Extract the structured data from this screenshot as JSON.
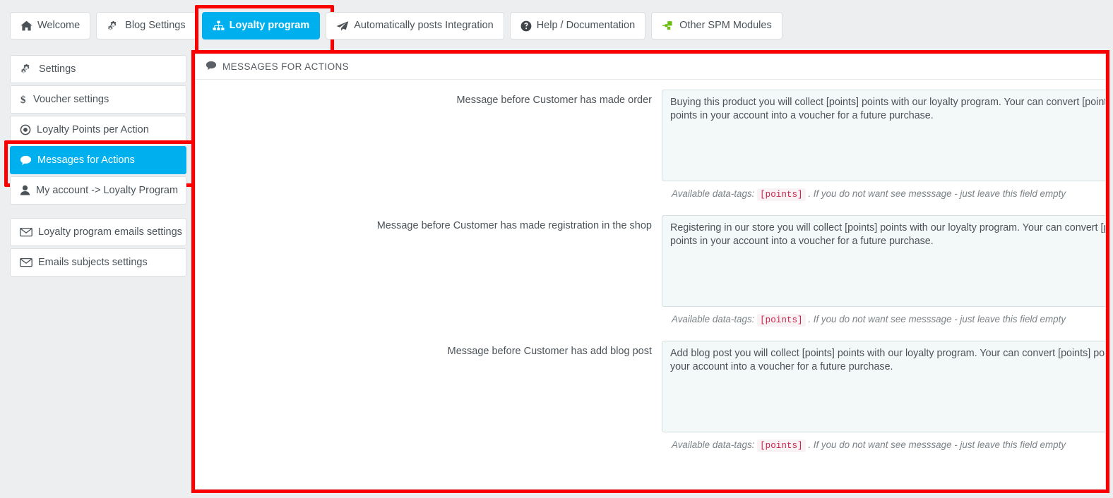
{
  "colors": {
    "accent": "#00b0ee",
    "annotation": "#fb0000",
    "page_bg": "#eceef0",
    "text": "#4c5358",
    "code": "#c7254e"
  },
  "tabs": [
    {
      "label": "Welcome",
      "icon": "home-icon",
      "active": false
    },
    {
      "label": "Blog Settings",
      "icon": "gears-icon",
      "active": false
    },
    {
      "label": "Loyalty program",
      "icon": "sitemap-icon",
      "active": true
    },
    {
      "label": "Automatically posts Integration",
      "icon": "paper-plane-icon",
      "active": false
    },
    {
      "label": "Help / Documentation",
      "icon": "question-circle-icon",
      "active": false
    },
    {
      "label": "Other SPM Modules",
      "icon": "puzzle-green-icon",
      "active": false
    }
  ],
  "sidebar": {
    "groups": [
      {
        "items": [
          {
            "label": "Settings",
            "icon": "gears-icon",
            "active": false
          },
          {
            "label": "Voucher settings",
            "icon": "dollar-icon",
            "active": false
          },
          {
            "label": "Loyalty Points per Action",
            "icon": "dot-circle-icon",
            "active": false
          },
          {
            "label": "Messages for Actions",
            "icon": "comment-icon",
            "active": true
          },
          {
            "label": "My account -> Loyalty Program",
            "icon": "user-icon",
            "active": false
          }
        ]
      },
      {
        "items": [
          {
            "label": "Loyalty program emails settings",
            "icon": "envelope-icon",
            "active": false
          },
          {
            "label": "Emails subjects settings",
            "icon": "envelope-icon",
            "active": false
          }
        ]
      }
    ]
  },
  "panel": {
    "title": "MESSAGES FOR ACTIONS",
    "title_icon": "comment-icon",
    "rows": [
      {
        "label": "Message before Customer has made order",
        "value": "Buying this product you will collect [points] points with our loyalty program. Your can convert [points] points in your account into a voucher for a future purchase.",
        "lang": "en",
        "hint_prefix": "Available data-tags:",
        "hint_tag": "[points]",
        "hint_suffix": ". If you do not want see messsage - just leave this field empty"
      },
      {
        "label": "Message before Customer has made registration in the shop",
        "value": "Registering in our store you will collect [points] points with our loyalty program. Your can convert [points] points in your account into a voucher for a future purchase.",
        "lang": "en",
        "hint_prefix": "Available data-tags:",
        "hint_tag": "[points]",
        "hint_suffix": ". If you do not want see messsage - just leave this field empty"
      },
      {
        "label": "Message before Customer has add blog post",
        "value": "Add blog post you will collect [points] points with our loyalty program. Your can convert [points] points in your account into a voucher for a future purchase.",
        "lang": "en",
        "hint_prefix": "Available data-tags:",
        "hint_tag": "[points]",
        "hint_suffix": ". If you do not want see messsage - just leave this field empty"
      }
    ]
  }
}
